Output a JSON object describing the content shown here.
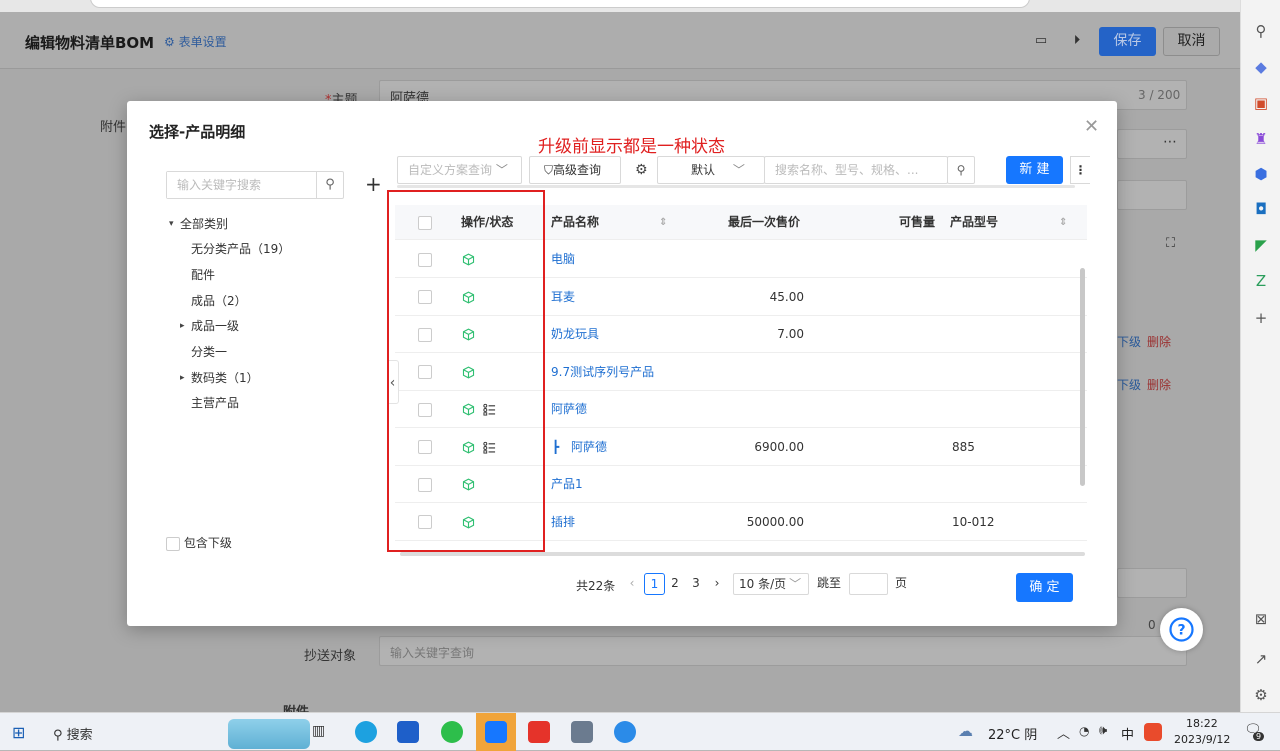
{
  "app": {
    "page_title": "编辑物料清单BOM",
    "form_settings": "表单设置",
    "save_label": "保存",
    "cancel_label": "取消",
    "subject_label": "主题",
    "subject_value": "阿萨德",
    "subject_count": "3 / 200",
    "attachment_label": "附件",
    "lower_level": "下级",
    "delete": "删除",
    "cc_label": "抄送对象",
    "cc_placeholder": "输入关键字查询",
    "attachment_section": "附件",
    "zero": "0"
  },
  "modal": {
    "title": "选择-产品明细",
    "annotation": "升级前显示都是一种状态",
    "search_placeholder": "输入关键字搜索",
    "tree": [
      {
        "label": "全部类别",
        "caret": "▾"
      },
      {
        "label": "无分类产品（19）"
      },
      {
        "label": "配件"
      },
      {
        "label": "成品（2）"
      },
      {
        "label": "成品一级",
        "caret": "▸"
      },
      {
        "label": "分类一"
      },
      {
        "label": "数码类（1）",
        "caret": "▸"
      },
      {
        "label": "主营产品"
      }
    ],
    "include_sub": "包含下级",
    "toolbar": {
      "custom_query": "自定义方案查询",
      "advanced": "高级查询",
      "default": "默认",
      "search_placeholder": "搜索名称、型号、规格、...",
      "new": "新 建"
    },
    "columns": {
      "op": "操作/状态",
      "name": "产品名称",
      "price": "最后一次售价",
      "qty": "可售量",
      "model": "产品型号"
    },
    "rows": [
      {
        "name": "电脑",
        "price": "",
        "model": "",
        "list": false,
        "child": false
      },
      {
        "name": "耳麦",
        "price": "45.00",
        "model": "",
        "list": false,
        "child": false
      },
      {
        "name": "奶龙玩具",
        "price": "7.00",
        "model": "",
        "list": false,
        "child": false
      },
      {
        "name": "9.7测试序列号产品",
        "price": "",
        "model": "",
        "list": false,
        "child": false
      },
      {
        "name": "阿萨德",
        "price": "",
        "model": "",
        "list": true,
        "child": false
      },
      {
        "name": "阿萨德",
        "price": "6900.00",
        "model": "885",
        "list": true,
        "child": true
      },
      {
        "name": "产品1",
        "price": "",
        "model": "",
        "list": false,
        "child": false
      },
      {
        "name": "插排",
        "price": "50000.00",
        "model": "10-012",
        "list": false,
        "child": false
      }
    ],
    "pagination": {
      "total": "共22条",
      "pages": [
        "1",
        "2",
        "3"
      ],
      "page_size": "10 条/页",
      "goto": "跳至",
      "page_unit": "页"
    },
    "confirm": "确 定"
  },
  "taskbar": {
    "search": "搜索",
    "weather": "22°C 阴",
    "ime": "中",
    "time": "18:22",
    "date": "2023/9/12",
    "notif": "9"
  },
  "colors": {
    "primary": "#1677ff",
    "link": "#1f6fd1",
    "annotation": "#e02020",
    "status_icon": "#2fbf71"
  }
}
